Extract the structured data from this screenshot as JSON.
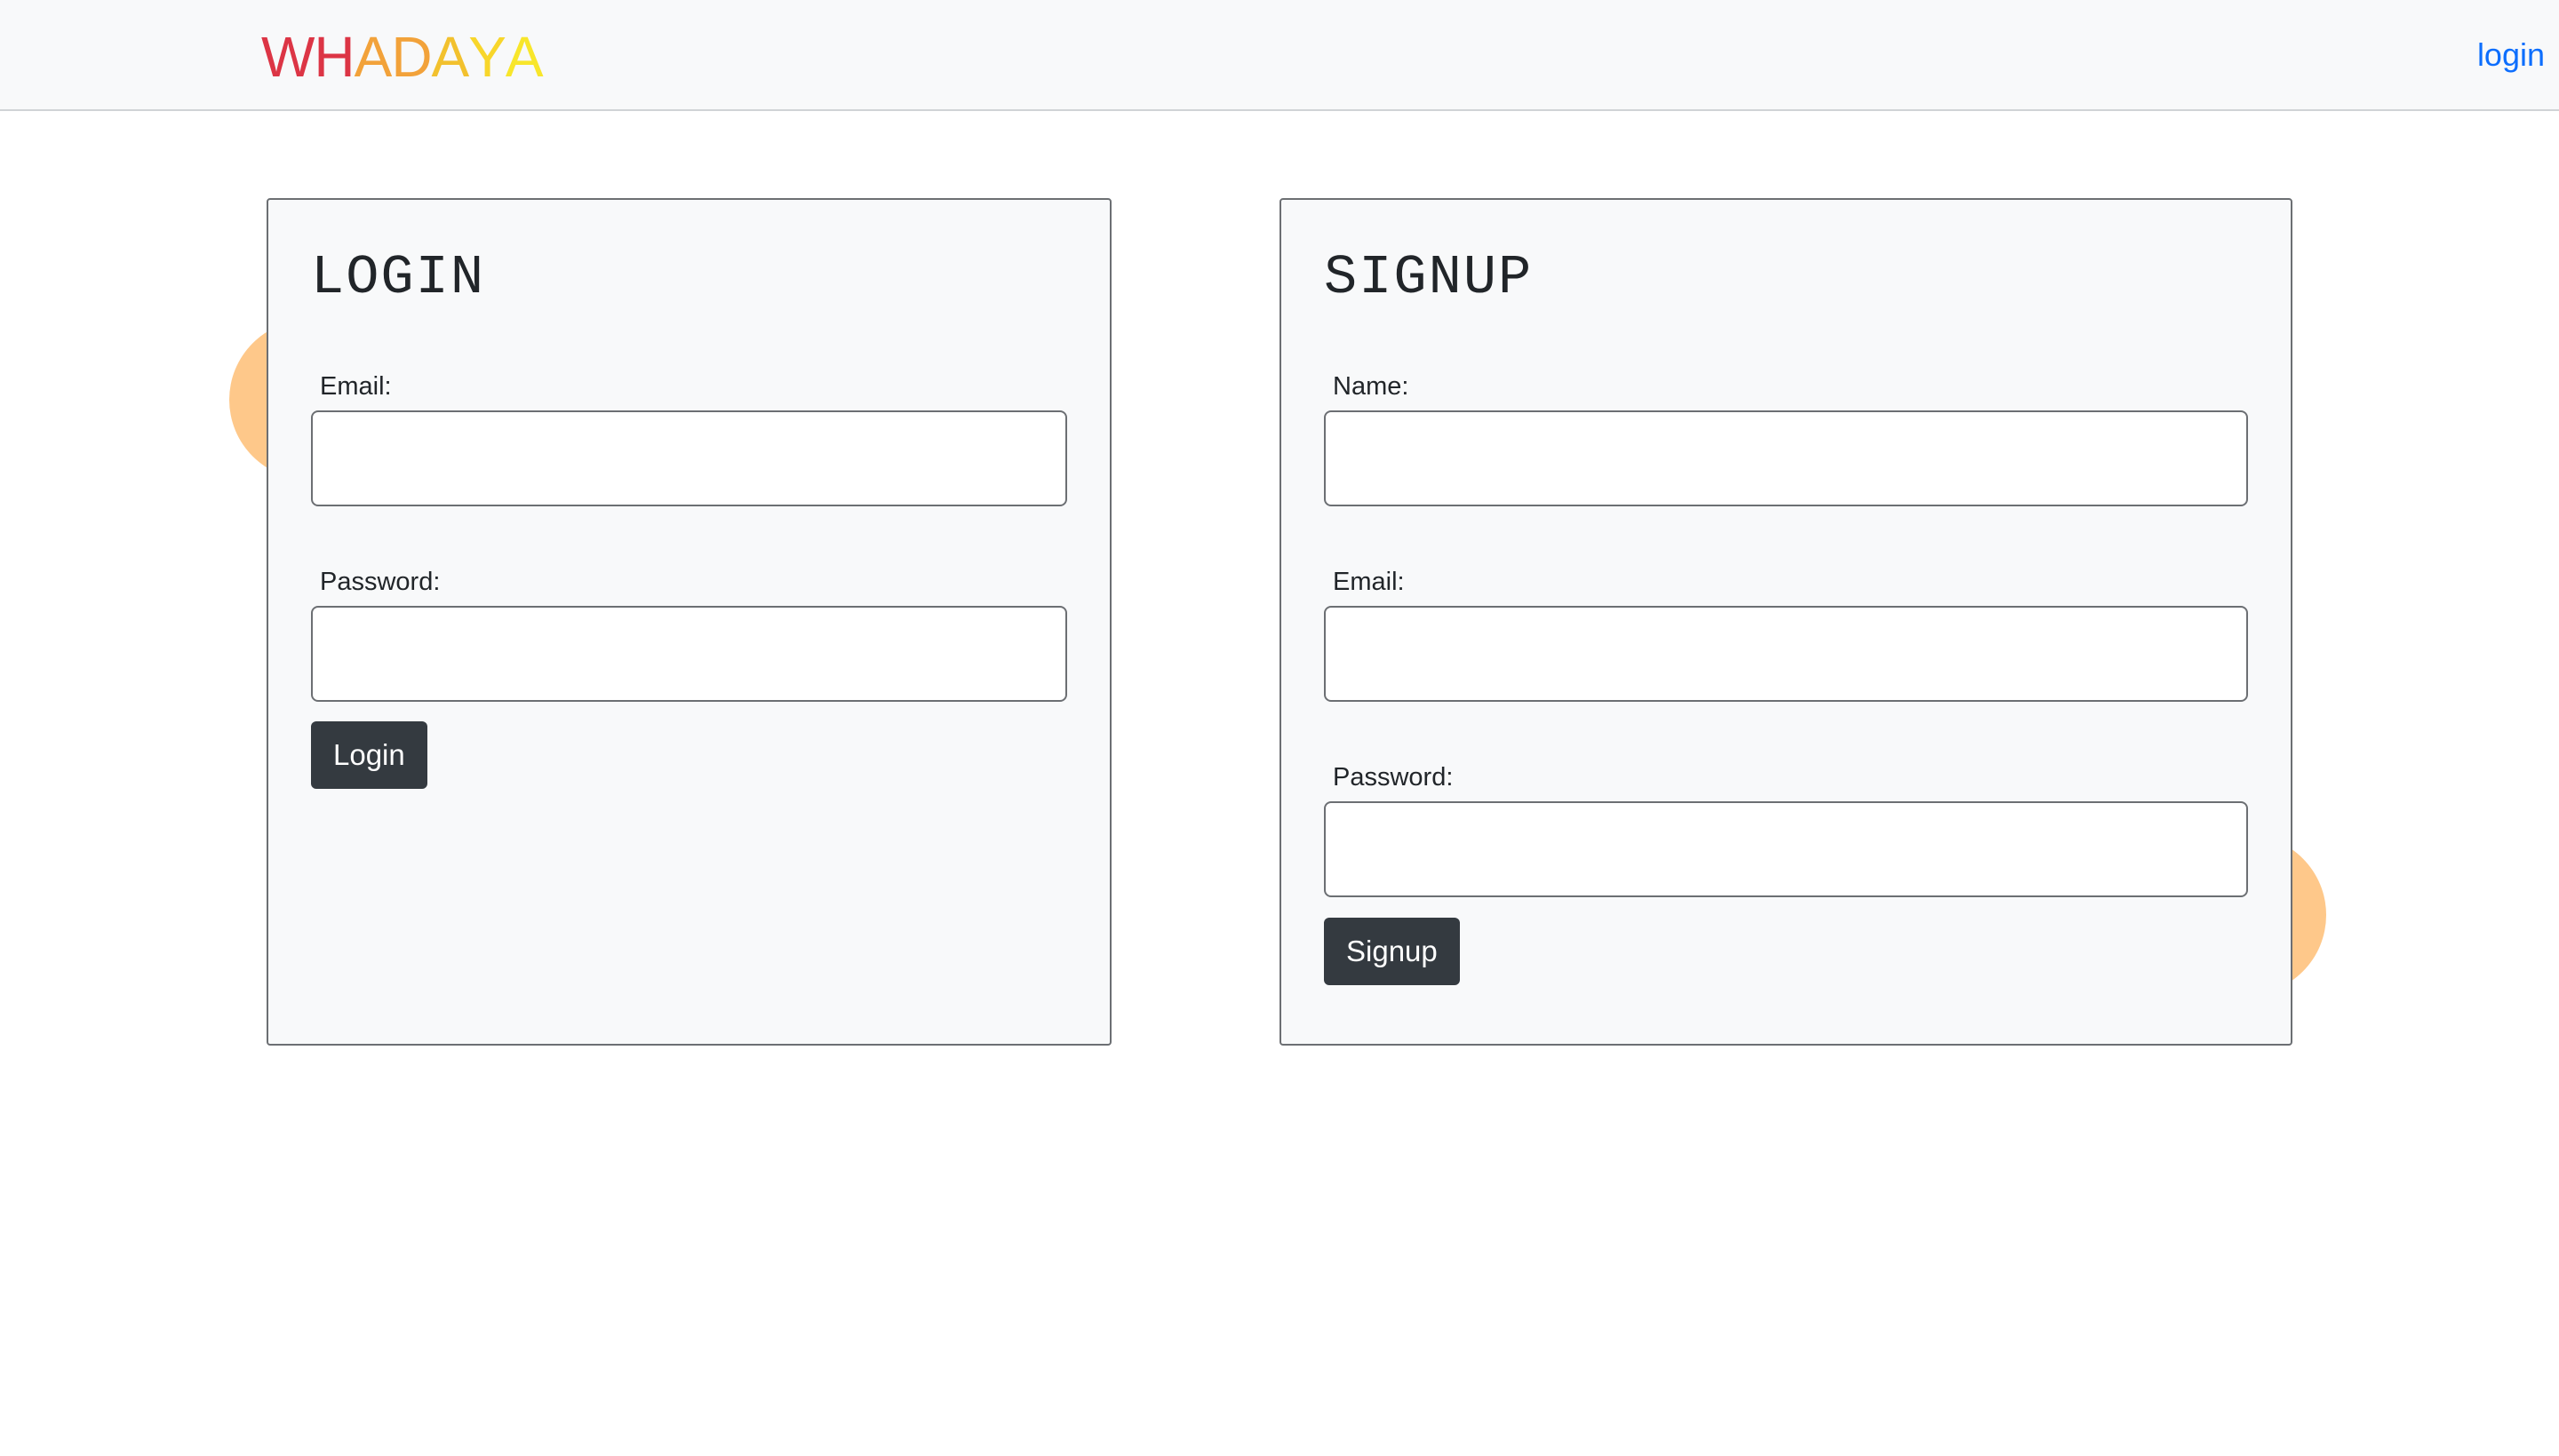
{
  "navbar": {
    "brand": {
      "letters": [
        {
          "char": "W",
          "color": "#dc3545"
        },
        {
          "char": "H",
          "color": "#dc3545"
        },
        {
          "char": "A",
          "color": "#f2a23a"
        },
        {
          "char": "D",
          "color": "#f2a23a"
        },
        {
          "char": "A",
          "color": "#f2c12e"
        },
        {
          "char": "Y",
          "color": "#f8d62b"
        },
        {
          "char": "A",
          "color": "#f8e62b"
        }
      ]
    },
    "login_link": "login"
  },
  "login_form": {
    "title": "LOGIN",
    "email_label": "Email:",
    "email_value": "",
    "password_label": "Password:",
    "password_value": "",
    "submit_label": "Login"
  },
  "signup_form": {
    "title": "SIGNUP",
    "name_label": "Name:",
    "name_value": "",
    "email_label": "Email:",
    "email_value": "",
    "password_label": "Password:",
    "password_value": "",
    "submit_label": "Signup"
  },
  "colors": {
    "navbar_bg": "#f8f9fa",
    "link": "#0d6efd",
    "button_bg": "#343a40",
    "blob": "#fec88a"
  }
}
